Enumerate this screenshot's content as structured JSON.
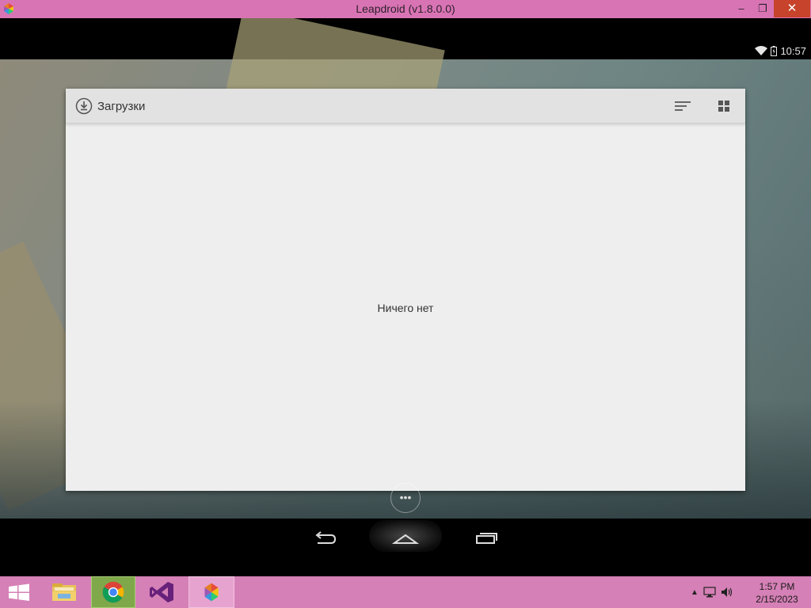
{
  "window": {
    "title": "Leapdroid (v1.8.0.0)",
    "minimize_glyph": "–",
    "maximize_glyph": "❐",
    "close_glyph": "✕"
  },
  "statusbar": {
    "time": "10:57",
    "icons": [
      "wifi-icon",
      "battery-icon"
    ]
  },
  "downloads": {
    "title": "Загрузки",
    "empty_text": "Ничего нет",
    "toolbar_icons": [
      "sort-icon",
      "grid-view-icon"
    ]
  },
  "navbar": {
    "buttons": [
      "back-icon",
      "home-icon",
      "recents-icon"
    ]
  },
  "taskbar": {
    "apps": [
      "windows-start-icon",
      "file-explorer-icon",
      "chrome-icon",
      "visual-studio-icon",
      "leapdroid-icon"
    ],
    "tray_icons": [
      "show-hidden-icons-arrow",
      "network-icon",
      "volume-icon"
    ],
    "time": "1:57 PM",
    "date": "2/15/2023"
  },
  "colors": {
    "titlebar": "#d974b4",
    "taskbar": "#d580b6",
    "close_button": "#c7432b",
    "app_background": "#eeeeee",
    "app_toolbar": "#e2e2e2"
  }
}
